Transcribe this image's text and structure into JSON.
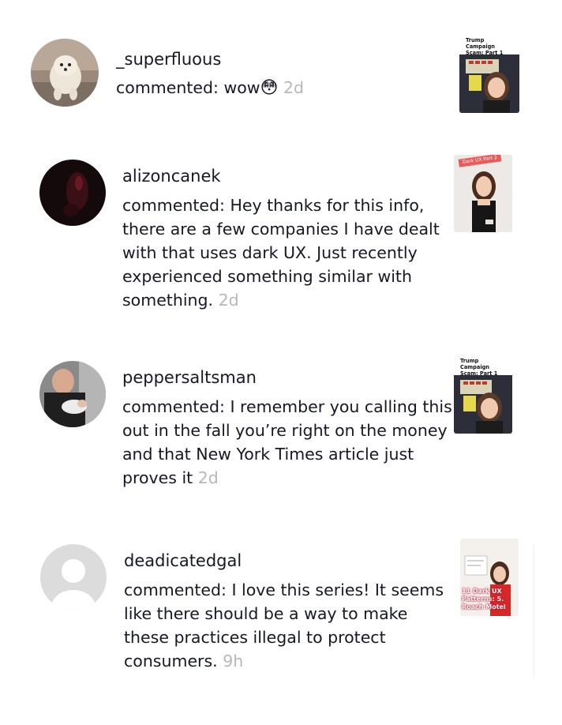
{
  "comments": [
    {
      "username": "_superfluous",
      "prefix": "commented: ",
      "text": "wow",
      "emoji": "😳",
      "time": "2d",
      "avatar_icon": "dog-photo-avatar",
      "thumb_caption": "Trump Campaign Scam: Part 1"
    },
    {
      "username": "alizoncanek",
      "prefix": "commented: ",
      "text": "Hey thanks for this info, there are a few companies I have dealt with that uses dark UX. Just recently experienced something similar with something.",
      "time": "2d",
      "avatar_icon": "dark-photo-avatar",
      "thumb_tag": "Dark UX Part 2"
    },
    {
      "username": "peppersaltsman",
      "prefix": "commented: ",
      "text": "I remember you calling this out in the fall you’re right on the money and that New York Times article just proves it",
      "time": "2d",
      "avatar_icon": "man-with-baby-avatar",
      "thumb_caption": "Trump Campaign Scam: Part 1"
    },
    {
      "username": "deadicatedgal",
      "prefix": "commented: ",
      "text": "I love this series! It seems like there should be a way to make these practices illegal to protect consumers.",
      "time": "9h",
      "avatar_icon": "default-user-avatar",
      "thumb_caption": "11 Dark UX Patterns: 5. Roach Motel"
    }
  ]
}
